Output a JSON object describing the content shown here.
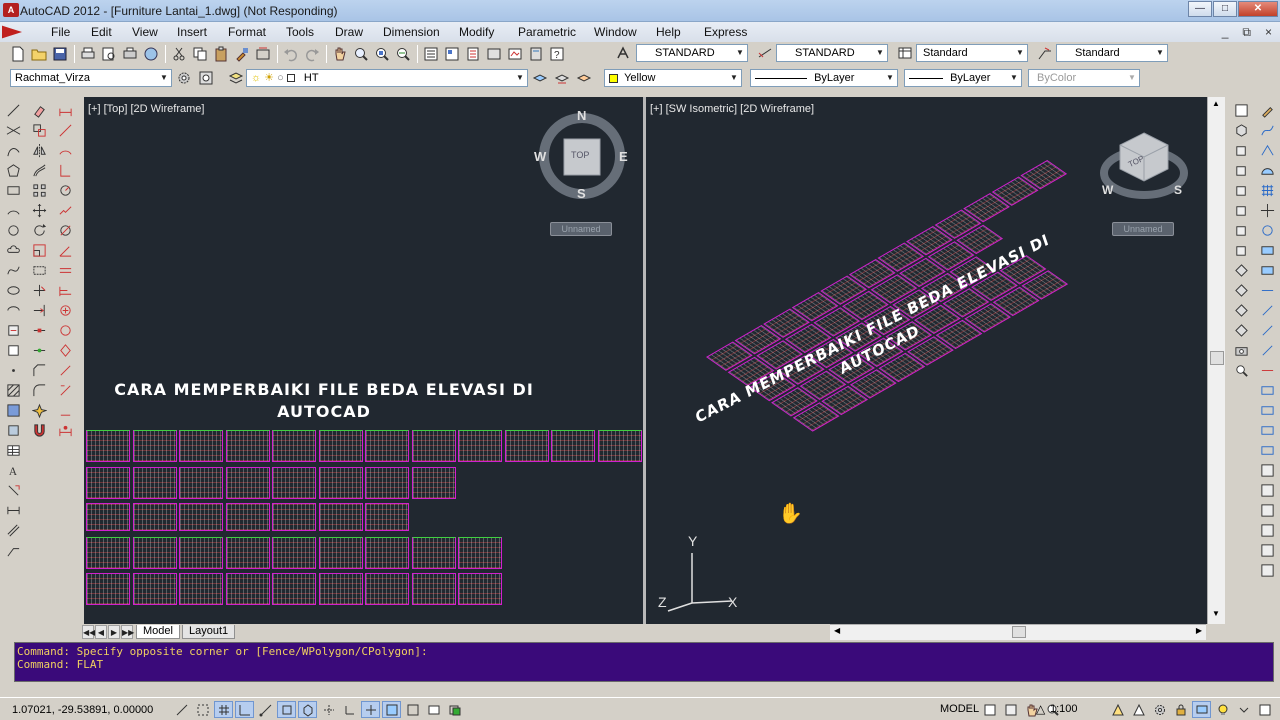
{
  "window": {
    "title": "AutoCAD 2012 - [Furniture Lantai_1.dwg] (Not Responding)",
    "app_icon": "A",
    "buttons": [
      "minimize-icon",
      "maximize-icon",
      "close-icon"
    ]
  },
  "menubar": {
    "items": [
      "File",
      "Edit",
      "View",
      "Insert",
      "Format",
      "Tools",
      "Draw",
      "Dimension",
      "Modify",
      "Parametric",
      "Window",
      "Help",
      "Express"
    ],
    "doc_buttons": [
      "_",
      "⧉",
      "×"
    ]
  },
  "toolbar_styles": {
    "text_style": "STANDARD",
    "dim_style": "STANDARD",
    "table_style": "Standard",
    "multileader_style": "Standard"
  },
  "toolbar_layers": {
    "workspace": "Rachmat_Virza",
    "layer": "HT",
    "color": "Yellow",
    "linetype": "ByLayer",
    "lineweight": "ByLayer",
    "plotstyle": "ByColor",
    "color_swatch": "#ffff00"
  },
  "viewport_left": {
    "label": "[+] [Top] [2D Wireframe]",
    "title_line1": "CARA MEMPERBAIKI FILE BEDA ELEVASI DI",
    "title_line2": "AUTOCAD",
    "compass": {
      "n": "N",
      "s": "S",
      "e": "E",
      "w": "W",
      "cube": "TOP"
    },
    "ucs_label": "Unnamed"
  },
  "viewport_right": {
    "label": "[+] [SW Isometric] [2D Wireframe]",
    "title_line1": "CARA MEMPERBAIKI FILE BEDA ELEVASI DI",
    "title_line2": "AUTOCAD",
    "compass": {
      "cube": "TOP",
      "w": "W",
      "s": "S"
    },
    "ucs_label": "Unnamed",
    "axes": {
      "x": "X",
      "y": "Y",
      "z": "Z"
    }
  },
  "layout_tabs": [
    "Model",
    "Layout1"
  ],
  "command_line": [
    "Command: Specify opposite corner or [Fence/WPolygon/CPolygon]:",
    "Command: FLAT"
  ],
  "statusbar": {
    "coords": "1.07021, -29.53891, 0.00000",
    "model": "MODEL",
    "scale": "1:100"
  },
  "colors": {
    "viewport_bg": "#212830",
    "command_bg": "#3a0a7a",
    "sheet_border": "#d020d0"
  }
}
